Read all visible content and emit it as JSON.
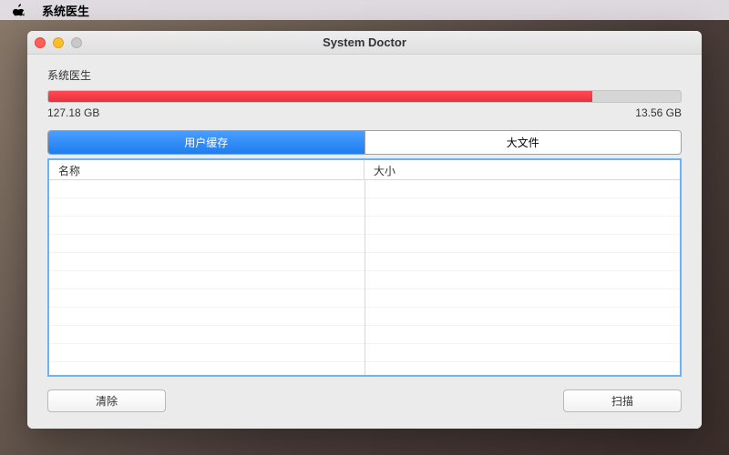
{
  "menubar": {
    "app_name": "系统医生"
  },
  "window": {
    "title": "System Doctor"
  },
  "storage": {
    "section_label": "系统医生",
    "used_label": "127.18 GB",
    "free_label": "13.56 GB",
    "used_percent": 86
  },
  "tabs": {
    "user_cache": "用户缓存",
    "large_files": "大文件"
  },
  "table": {
    "columns": {
      "name": "名称",
      "size": "大小"
    }
  },
  "buttons": {
    "clear": "清除",
    "scan": "扫描"
  }
}
